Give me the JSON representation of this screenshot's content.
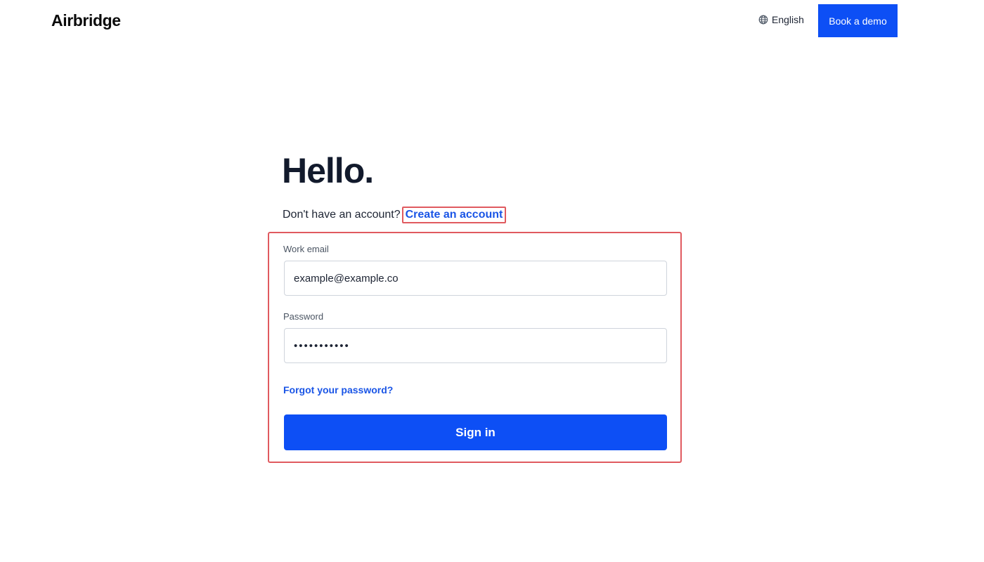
{
  "header": {
    "logo_text": "Airbridge",
    "language_label": "English",
    "language_icon": "globe-icon",
    "demo_button_label": "Book a demo"
  },
  "main": {
    "greeting": "Hello.",
    "no_account_text": "Don't have an account?",
    "create_account_link": "Create an account",
    "form": {
      "email_label": "Work email",
      "email_value": "example@example.co",
      "password_label": "Password",
      "password_masked": "•••••••••••",
      "forgot_link": "Forgot your password?",
      "submit_label": "Sign in"
    }
  },
  "colors": {
    "accent": "#0d4ff5",
    "link": "#1a55e6",
    "highlight_border": "#e05a5f"
  }
}
